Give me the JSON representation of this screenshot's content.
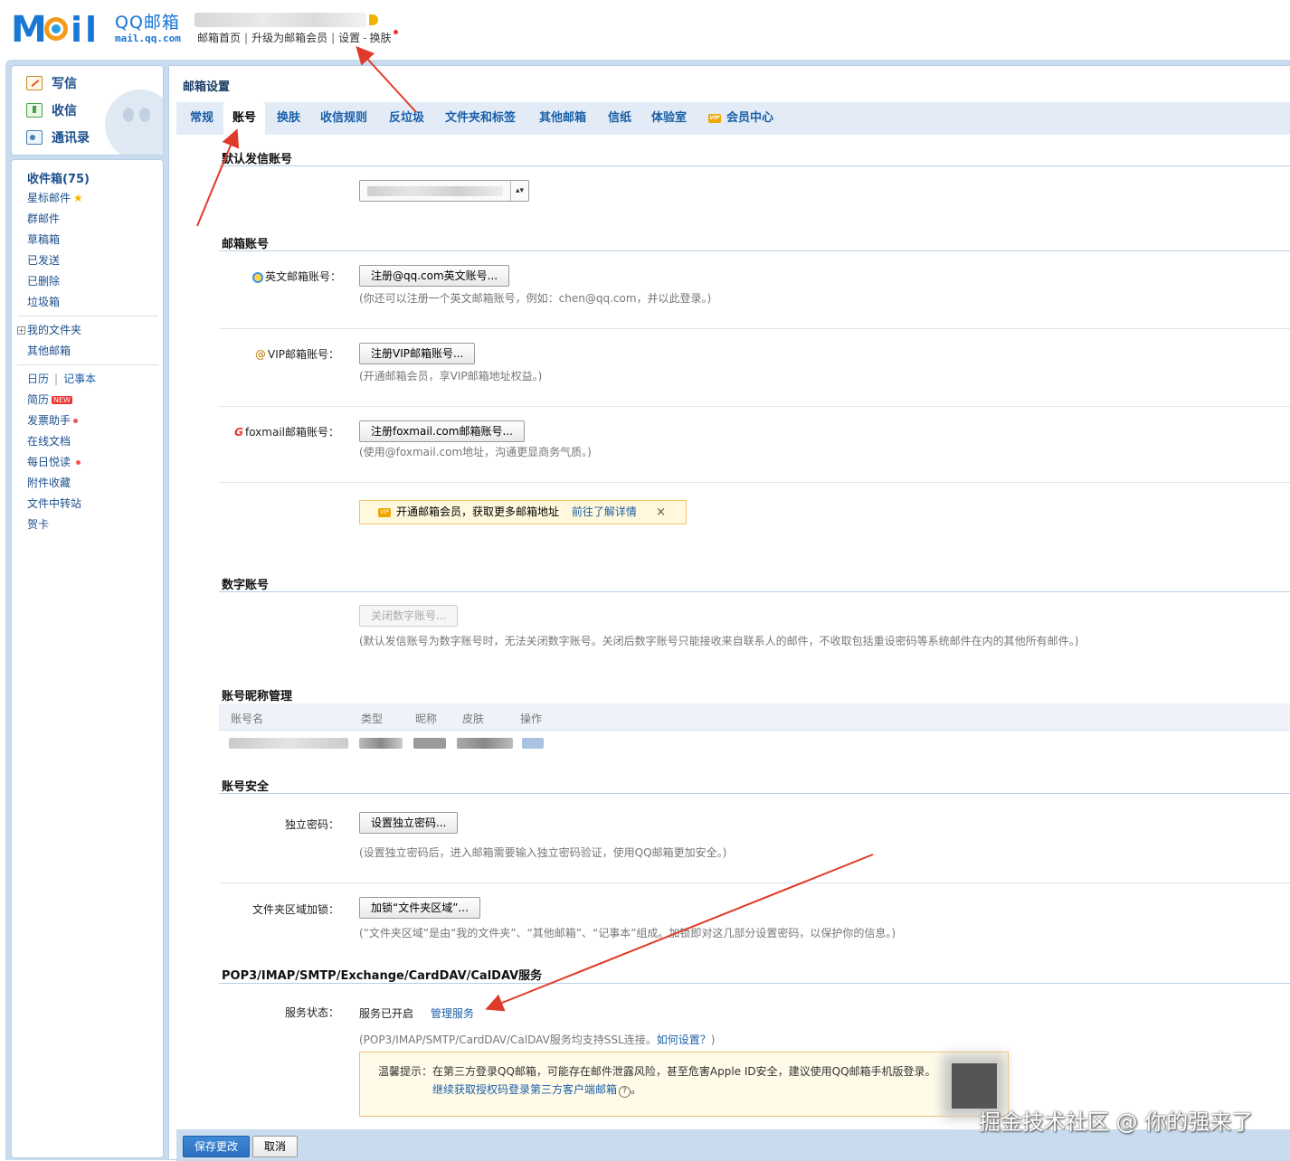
{
  "header": {
    "logo_cn": "QQ邮箱",
    "logo_en": "mail.qq.com",
    "links": [
      "邮箱首页",
      "升级为邮箱会员",
      "设置",
      "换肤"
    ],
    "link_sep": "|",
    "link_dash": "-"
  },
  "sidebar": {
    "actions": {
      "write": "写信",
      "receive": "收信",
      "contacts": "通讯录"
    },
    "inbox": "收件箱(75)",
    "folders": [
      "星标邮件",
      "群邮件",
      "草稿箱",
      "已发送",
      "已删除",
      "垃圾箱"
    ],
    "my_folders": "我的文件夹",
    "other_mailbox": "其他邮箱",
    "calendar": "日历",
    "notebook": "记事本",
    "apps": [
      "简历",
      "发票助手",
      "在线文档",
      "每日悦读",
      "附件收藏",
      "文件中转站",
      "贺卡"
    ],
    "new_badge": "NEW"
  },
  "main": {
    "title": "邮箱设置",
    "tabs": [
      "常规",
      "账号",
      "换肤",
      "收信规则",
      "反垃圾",
      "文件夹和标签",
      "其他邮箱",
      "信纸",
      "体验室",
      "会员中心"
    ],
    "vip_mark": "VIP",
    "active_tab": "账号"
  },
  "default_sender": {
    "title": "默认发信账号"
  },
  "mail_accounts": {
    "title": "邮箱账号",
    "english": {
      "label": "英文邮箱账号：",
      "button": "注册@qq.com英文账号...",
      "hint": "(你还可以注册一个英文邮箱账号，例如：chen@qq.com，并以此登录。)"
    },
    "vip": {
      "label": "VIP邮箱账号：",
      "button": "注册VIP邮箱账号...",
      "hint": "(开通邮箱会员，享VIP邮箱地址权益。)"
    },
    "foxmail": {
      "label": "foxmail邮箱账号：",
      "button": "注册foxmail.com邮箱账号...",
      "hint": "(使用@foxmail.com地址，沟通更显商务气质。)"
    },
    "promo": {
      "text": "开通邮箱会员，获取更多邮箱地址",
      "link": "前往了解详情",
      "close": "×"
    }
  },
  "digital_account": {
    "title": "数字账号",
    "button": "关闭数字账号...",
    "hint": "(默认发信账号为数字账号时，无法关闭数字账号。关闭后数字账号只能接收来自联系人的邮件，不收取包括重设密码等系统邮件在内的其他所有邮件。)"
  },
  "nickname": {
    "title": "账号昵称管理",
    "columns": [
      "账号名",
      "类型",
      "昵称",
      "皮肤",
      "操作"
    ]
  },
  "security": {
    "title": "账号安全",
    "password": {
      "label": "独立密码：",
      "button": "设置独立密码...",
      "hint": "(设置独立密码后，进入邮箱需要输入独立密码验证，使用QQ邮箱更加安全。)"
    },
    "folder_lock": {
      "label": "文件夹区域加锁：",
      "button": "加锁“文件夹区域”...",
      "hint": "(“文件夹区域”是由“我的文件夹”、“其他邮箱”、“记事本”组成。加锁即对这几部分设置密码，以保护你的信息。)"
    }
  },
  "pop": {
    "title": "POP3/IMAP/SMTP/Exchange/CardDAV/CalDAV服务",
    "status_label": "服务状态：",
    "status_value": "服务已开启",
    "manage_link": "管理服务",
    "hint": "(POP3/IMAP/SMTP/CardDAV/CalDAV服务均支持SSL连接。",
    "hint_link": "如何设置？",
    "hint_end": ")",
    "warning": "温馨提示：在第三方登录QQ邮箱，可能存在邮件泄露风险，甚至危害Apple ID安全，建议使用QQ邮箱手机版登录。",
    "warning_link": "继续获取授权码登录第三方客户端邮箱",
    "warning_q": "?",
    "warning_end": "。"
  },
  "footer": {
    "save": "保存更改",
    "cancel": "取消"
  },
  "watermark": "掘金技术社区 @ 你的强来了",
  "colors": {
    "accent": "#1c5ea6",
    "frame": "#c9dcef",
    "arrow": "#e03a2a",
    "promo_bg": "#fff8dc"
  }
}
